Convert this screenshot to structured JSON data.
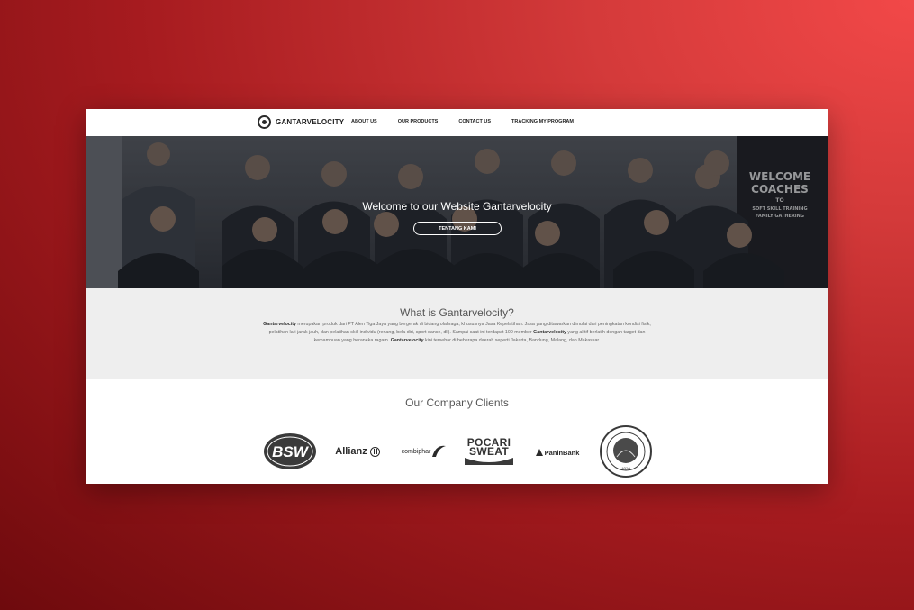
{
  "navbar": {
    "brand": "GANTARVELOCITY",
    "links": [
      "ABOUT US",
      "OUR PRODUCTS",
      "CONTACT US",
      "TRACKING MY PROGRAM"
    ]
  },
  "hero": {
    "title": "Welcome to our Website Gantarvelocity",
    "button_label": "TENTANG KAMI",
    "banner_lines": [
      "WELCOME",
      "COACHES",
      "TO",
      "SOFT SKILL TRAINING",
      "FAMILY GATHERING"
    ]
  },
  "about": {
    "title": "What is Gantarvelocity?",
    "brand_1": "Gantarvelocity",
    "text_1": " merupakan produk dari PT Alen Tiga Jaya yang bergerak di bidang olahraga, khususnya Jasa Kepelatihan. Jasa yang ditawarkan dimulai dari peningkatan kondisi fisik, pelatihan lari jarak jauh, dan pelatihan skill individu (renang, bela diri, sport dance, dll). Sampai saat ini terdapat 100 member ",
    "brand_2": "Gantarvelocity",
    "text_2": " yang aktif berlatih dengan target dan kemampuan yang beraneka ragam. ",
    "brand_3": "Gantarvelocity",
    "text_3": " kini tersebar di beberapa daerah seperti Jakarta, Bandung, Malang, dan Makassar."
  },
  "clients": {
    "title": "Our Company Clients",
    "logos": {
      "bsw": "BSW",
      "allianz": "Allianz",
      "combiphar": "combiphar",
      "pocari_line1": "POCARI",
      "pocari_line2": "SWEAT",
      "panin": "PaninBank",
      "itb_year": "1920"
    }
  },
  "colors": {
    "background_light": "#f24848",
    "background_dark": "#6e0a0d",
    "about_bg": "#eeeeee"
  }
}
